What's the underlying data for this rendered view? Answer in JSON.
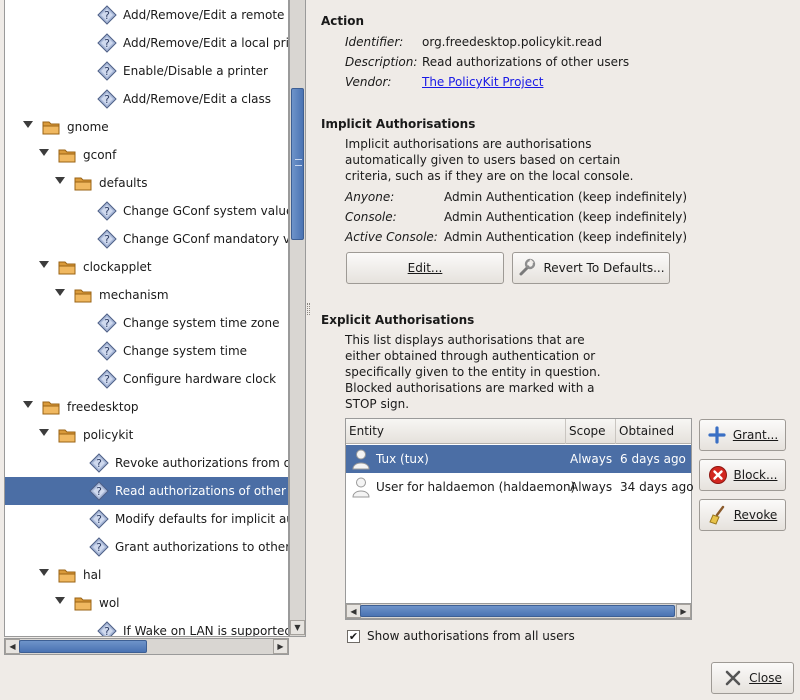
{
  "tree": {
    "items": [
      {
        "label": "Add/Remove/Edit a remote pr",
        "kind": "action"
      },
      {
        "label": "Add/Remove/Edit a local print",
        "kind": "action"
      },
      {
        "label": "Enable/Disable a printer",
        "kind": "action"
      },
      {
        "label": "Add/Remove/Edit a class",
        "kind": "action"
      },
      {
        "label": "gnome",
        "kind": "folder"
      },
      {
        "label": "gconf",
        "kind": "folder"
      },
      {
        "label": "defaults",
        "kind": "folder"
      },
      {
        "label": "Change GConf system values",
        "kind": "action"
      },
      {
        "label": "Change GConf mandatory valu",
        "kind": "action"
      },
      {
        "label": "clockapplet",
        "kind": "folder"
      },
      {
        "label": "mechanism",
        "kind": "folder"
      },
      {
        "label": "Change system time zone",
        "kind": "action"
      },
      {
        "label": "Change system time",
        "kind": "action"
      },
      {
        "label": "Configure hardware clock",
        "kind": "action"
      },
      {
        "label": "freedesktop",
        "kind": "folder"
      },
      {
        "label": "policykit",
        "kind": "folder"
      },
      {
        "label": "Revoke authorizations from othe",
        "kind": "action"
      },
      {
        "label": "Read authorizations of other use",
        "kind": "action",
        "selected": true
      },
      {
        "label": "Modify defaults for implicit autho",
        "kind": "action"
      },
      {
        "label": "Grant authorizations to other use",
        "kind": "action"
      },
      {
        "label": "hal",
        "kind": "folder"
      },
      {
        "label": "wol",
        "kind": "folder"
      },
      {
        "label": "If Wake on LAN is supported",
        "kind": "action"
      }
    ]
  },
  "action": {
    "title": "Action",
    "identifier_key": "Identifier:",
    "identifier": "org.freedesktop.policykit.read",
    "description_key": "Description:",
    "description": "Read authorizations of other users",
    "vendor_key": "Vendor:",
    "vendor": "The PolicyKit Project"
  },
  "implicit": {
    "title": "Implicit Authorisations",
    "desc_lines": [
      "Implicit authorisations are authorisations",
      "automatically given to users based on certain",
      "criteria, such as if they are on the local console."
    ],
    "anyone_key": "Anyone:",
    "anyone": "Admin Authentication (keep indefinitely)",
    "console_key": "Console:",
    "console": "Admin Authentication (keep indefinitely)",
    "active_key": "Active Console:",
    "active": "Admin Authentication (keep indefinitely)",
    "edit_label": "Edit...",
    "revert_label": "Revert To Defaults..."
  },
  "explicit": {
    "title": "Explicit Authorisations",
    "desc_lines": [
      "This list displays authorisations that are",
      "either obtained through authentication or",
      "specifically given to the entity in question.",
      "Blocked authorisations are marked with a",
      "STOP sign."
    ],
    "columns": [
      "Entity",
      "Scope",
      "Obtained"
    ],
    "rows": [
      {
        "entity": "Tux (tux)",
        "scope": "Always",
        "obtained": "6 days ago",
        "selected": true
      },
      {
        "entity": "User for haldaemon (haldaemon)",
        "scope": "Always",
        "obtained": "34 days ago"
      }
    ],
    "grant_label": "Grant...",
    "block_label": "Block...",
    "revoke_label": "Revoke",
    "show_all_label": "Show authorisations from all users",
    "show_all_checked": true
  },
  "close_label": "Close",
  "colors": {
    "selection": "#4b6ea5",
    "window_bg": "#efebe7",
    "link": "#1a1ae6"
  }
}
